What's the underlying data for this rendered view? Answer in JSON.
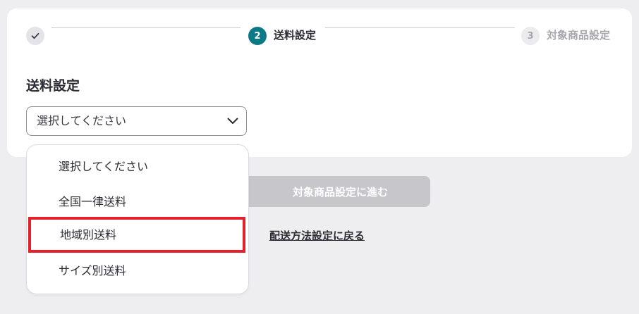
{
  "stepper": {
    "steps": [
      {
        "number": "",
        "label": "",
        "state": "done",
        "icon": "check-icon"
      },
      {
        "number": "2",
        "label": "送料設定",
        "state": "active"
      },
      {
        "number": "3",
        "label": "対象商品設定",
        "state": "upcoming"
      }
    ]
  },
  "colors": {
    "active": "#0c7a86",
    "done_bg": "#e4e4e8",
    "upcoming_bg": "#ececef",
    "disabled_button": "#c6c6cb",
    "highlight_border": "#e3202b"
  },
  "shipping": {
    "section_title": "送料設定",
    "select": {
      "value": "選択してください",
      "options": [
        "選択してください",
        "全国一律送料",
        "地域別送料",
        "サイズ別送料"
      ],
      "highlighted_option": "地域別送料"
    }
  },
  "actions": {
    "next_label": "対象商品設定に進む",
    "back_label": "配送方法設定に戻る"
  }
}
